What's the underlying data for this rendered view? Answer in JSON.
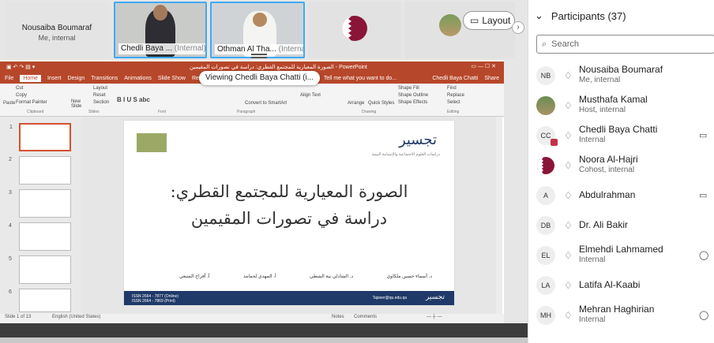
{
  "tiles": [
    {
      "name": "Nousaiba Boumaraf",
      "role": "Me, internal"
    },
    {
      "name": "Chedli Baya ...",
      "sub": "(Internal)"
    },
    {
      "name": "Othman Al Tha...",
      "sub": "(Internal)"
    }
  ],
  "layout_label": "Layout",
  "viewing_label": "Viewing Chedli Baya Chatti (i...",
  "ppt": {
    "title": "الصورة المعيارية للمجتمع القطري: دراسة في تصورات المقيمين - PowerPoint",
    "tabs": [
      "File",
      "Home",
      "Insert",
      "Design",
      "Transitions",
      "Animations",
      "Slide Show",
      "Review"
    ],
    "tell": "Tell me what you want to do...",
    "user": "Chedli Baya Chatti",
    "share": "Share",
    "groups": [
      "Clipboard",
      "Slides",
      "Font",
      "Paragraph",
      "Drawing",
      "Editing"
    ],
    "ribbon_items": [
      "Cut",
      "Copy",
      "Format Painter",
      "Paste",
      "New Slide",
      "Layout",
      "Reset",
      "Section",
      "Find",
      "Replace",
      "Select",
      "Shape Fill",
      "Shape Outline",
      "Shape Effects",
      "Arrange",
      "Quick Styles",
      "Align Text",
      "Convert to SmartArt"
    ],
    "thumb_numbers": [
      "1",
      "2",
      "3",
      "4",
      "5",
      "6"
    ],
    "status_left": "Slide 1 of 13",
    "status_lang": "English (United States)",
    "status_notes": "Notes",
    "status_comments": "Comments",
    "slide": {
      "line1": "الصورة المعيارية للمجتمع القطري:",
      "line2": "دراسة في تصورات المقيمين",
      "brand": "تجسير",
      "brand_sub": "دراسات العلوم الاجتماعية والإنسانية البينية",
      "authors": [
        "د. أسماء حسين ملكاوي",
        "د. الشاذلي بية الشطي",
        "أ. المهدي لحمامد",
        "أ. أفراح المنيعي"
      ],
      "issn": "ISSN 2664 - 7877 (Online)\nISSN 2664 - 7869 (Print)",
      "email": "Tajseer@qu.edu.qa",
      "brand_footer": "تجسير"
    }
  },
  "panel": {
    "title": "Participants (37)",
    "search_placeholder": "Search",
    "participants": [
      {
        "initials": "NB",
        "name": "Nousaiba Boumaraf",
        "role": "Me, internal",
        "icon": ""
      },
      {
        "initials": "",
        "name": "Musthafa Kamal",
        "role": "Host, internal",
        "icon": ""
      },
      {
        "initials": "CC",
        "name": "Chedli Baya Chatti",
        "role": "Internal",
        "icon": "camera-icon"
      },
      {
        "initials": "",
        "name": "Noora Al-Hajri",
        "role": "Cohost, internal",
        "icon": ""
      },
      {
        "initials": "A",
        "name": "Abdulrahman",
        "role": "",
        "icon": "camera-icon"
      },
      {
        "initials": "DB",
        "name": "Dr. Ali Bakir",
        "role": "",
        "icon": ""
      },
      {
        "initials": "EL",
        "name": "Elmehdi Lahmamed",
        "role": "Internal",
        "icon": "chat-icon"
      },
      {
        "initials": "LA",
        "name": "Latifa Al-Kaabi",
        "role": "",
        "icon": ""
      },
      {
        "initials": "MH",
        "name": "Mehran Haghirian",
        "role": "Internal",
        "icon": "chat-icon"
      }
    ]
  },
  "colors": {
    "ppt_red": "#b7472a",
    "accent_blue": "#3fa9f5",
    "qatar_maroon": "#8a1538",
    "slide_navy": "#1f3a68"
  }
}
